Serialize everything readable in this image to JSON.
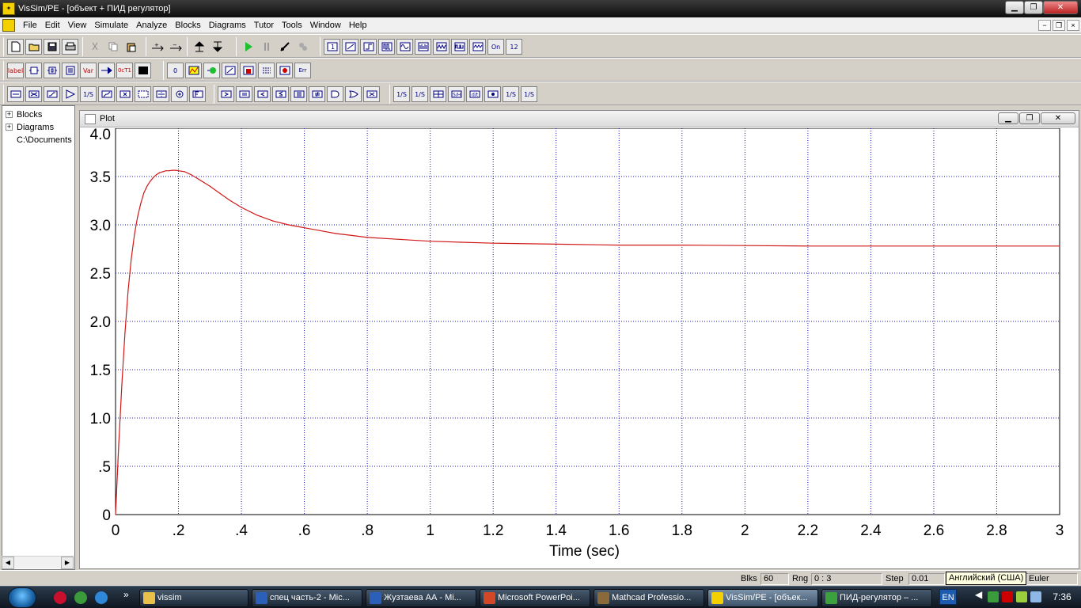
{
  "window": {
    "title": "VisSim/PE - [объект + ПИД регулятор]",
    "controls": {
      "minimize": "▁",
      "restore": "❐",
      "close": "✕"
    }
  },
  "menu": [
    "File",
    "Edit",
    "View",
    "Simulate",
    "Analyze",
    "Blocks",
    "Diagrams",
    "Tutor",
    "Tools",
    "Window",
    "Help"
  ],
  "mdi_controls": {
    "minimize": "−",
    "restore": "❐",
    "close": "×"
  },
  "toolbar_labels": {
    "label": "label",
    "var": "Var",
    "oct": "0cT1",
    "const0": "0",
    "err": "Err",
    "on": "On",
    "num12": "12",
    "frac": "1/S"
  },
  "tree": {
    "items": [
      {
        "label": "Blocks",
        "expander": "+"
      },
      {
        "label": "Diagrams",
        "expander": "+"
      },
      {
        "label": "C:\\Documents",
        "expander": ""
      }
    ],
    "scroll_left": "◀",
    "scroll_right": "▶"
  },
  "plot": {
    "title": "Plot",
    "controls": {
      "minimize": "▁",
      "restore": "❐",
      "close": "✕"
    }
  },
  "chart_data": {
    "type": "line",
    "title": "",
    "xlabel": "Time (sec)",
    "ylabel": "",
    "xlim": [
      0,
      3
    ],
    "ylim": [
      0,
      4
    ],
    "grid": true,
    "xticks": [
      0,
      0.2,
      0.4,
      0.6,
      0.8,
      1,
      1.2,
      1.4,
      1.6,
      1.8,
      2,
      2.2,
      2.4,
      2.6,
      2.8,
      3
    ],
    "xtick_labels": [
      "0",
      ".2",
      ".4",
      ".6",
      ".8",
      "1",
      "1.2",
      "1.4",
      "1.6",
      "1.8",
      "2",
      "2.2",
      "2.4",
      "2.6",
      "2.8",
      "3"
    ],
    "yticks": [
      0,
      0.5,
      1,
      1.5,
      2,
      2.5,
      3,
      3.5,
      4
    ],
    "ytick_labels": [
      "0",
      ".5",
      "1.0",
      "1.5",
      "2.0",
      "2.5",
      "3.0",
      "3.5",
      "4.0"
    ],
    "series": [
      {
        "color": "#d01818",
        "x": [
          0,
          0.01,
          0.02,
          0.03,
          0.04,
          0.05,
          0.06,
          0.07,
          0.08,
          0.09,
          0.1,
          0.11,
          0.12,
          0.13,
          0.14,
          0.15,
          0.16,
          0.17,
          0.18,
          0.19,
          0.2,
          0.21,
          0.22,
          0.24,
          0.26,
          0.28,
          0.3,
          0.33,
          0.36,
          0.4,
          0.45,
          0.5,
          0.55,
          0.6,
          0.65,
          0.7,
          0.75,
          0.8,
          0.9,
          1.0,
          1.1,
          1.2,
          1.4,
          1.6,
          1.8,
          2.0,
          2.2,
          2.4,
          2.6,
          2.8,
          3.0
        ],
        "y": [
          0,
          0.72,
          1.35,
          1.88,
          2.32,
          2.65,
          2.9,
          3.08,
          3.22,
          3.33,
          3.4,
          3.45,
          3.49,
          3.52,
          3.54,
          3.55,
          3.56,
          3.56,
          3.565,
          3.565,
          3.56,
          3.555,
          3.55,
          3.52,
          3.48,
          3.44,
          3.4,
          3.33,
          3.26,
          3.18,
          3.1,
          3.04,
          3.0,
          2.97,
          2.94,
          2.91,
          2.89,
          2.87,
          2.85,
          2.83,
          2.82,
          2.81,
          2.8,
          2.79,
          2.79,
          2.785,
          2.78,
          2.78,
          2.78,
          2.78,
          2.78
        ]
      }
    ]
  },
  "status": {
    "blks_label": "Blks",
    "blks_value": "60",
    "rng_label": "Rng",
    "rng_value": "0 : 3",
    "step_label": "Step",
    "step_value": "0.01",
    "method": "Euler"
  },
  "tooltip": "Английский (США)",
  "taskbar": {
    "chevron": "»",
    "buttons": [
      {
        "label": "vissim",
        "color": "#e8c04a"
      },
      {
        "label": "спец часть-2 - Mic...",
        "color": "#2b5fb8"
      },
      {
        "label": "Жузтаева АА - Mi...",
        "color": "#2b5fb8"
      },
      {
        "label": "Microsoft PowerPoi...",
        "color": "#d24726"
      },
      {
        "label": "Mathcad Professio...",
        "color": "#8a6a3a"
      },
      {
        "label": "VisSim/PE - [объек...",
        "color": "#f4d000"
      },
      {
        "label": "ПИД-регулятор – ...",
        "color": "#3ca03c"
      }
    ],
    "lang": "EN",
    "clock": "7:36"
  },
  "colors": {
    "grid": "#1a1ab0",
    "trace": "#d01818",
    "plot_bg": "#ffffff"
  }
}
